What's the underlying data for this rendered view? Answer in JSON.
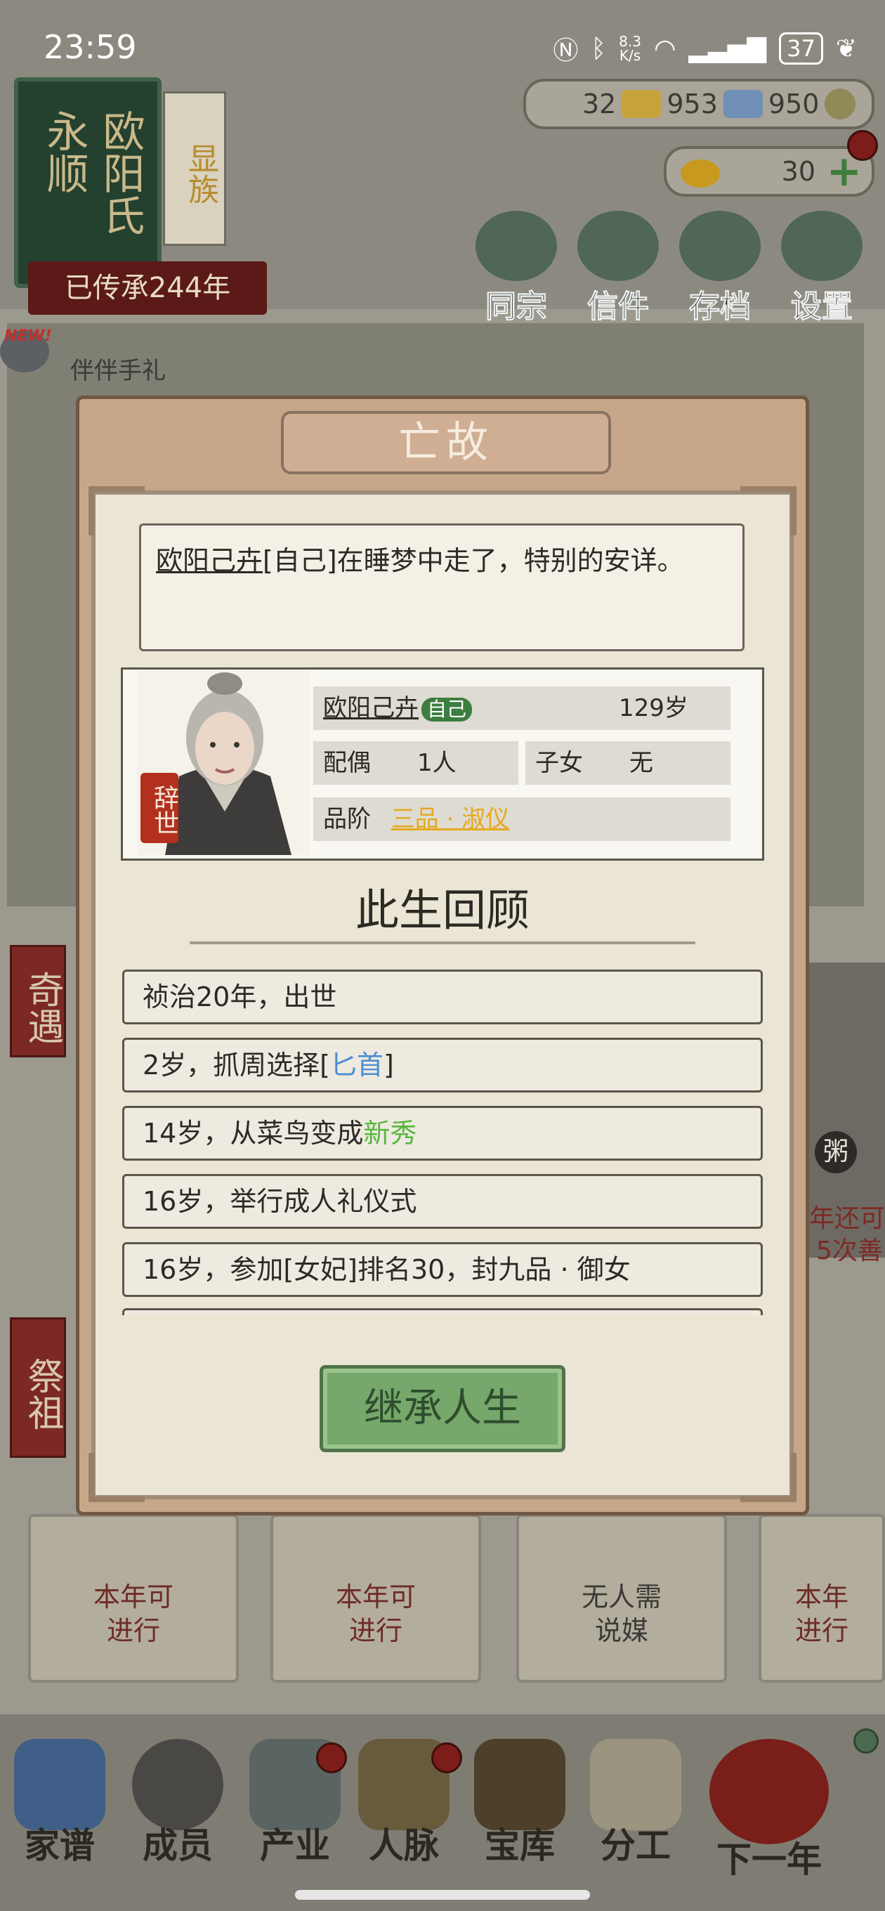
{
  "status_bar": {
    "time": "23:59",
    "net_speed_value": "8.3",
    "net_speed_unit": "K/s",
    "battery": "37"
  },
  "clan": {
    "name_col1": "欧阳氏",
    "name_col2": "永顺",
    "rank": "显族",
    "heritage": "已传承244年"
  },
  "currency": {
    "gold_bars": "32",
    "silver": "953",
    "coins": "950",
    "ingots": "30"
  },
  "top_menu": [
    {
      "label": "同宗",
      "icon": "book-icon"
    },
    {
      "label": "信件",
      "icon": "letter-icon"
    },
    {
      "label": "存档",
      "icon": "brush-icon"
    },
    {
      "label": "设置",
      "icon": "gear-icon"
    }
  ],
  "background": {
    "new_badge": "NEW!",
    "scroll_text": "伴伴手礼",
    "side_tag_1": "奇遇",
    "side_tag_2": "祭祖",
    "side_right_1": "年还可",
    "side_right_2": "5次善",
    "porridge": "粥",
    "cards": [
      {
        "line1": "本年可",
        "line2": "进行"
      },
      {
        "line1": "本年可",
        "line2": "进行"
      },
      {
        "line1": "无人需",
        "line2": "说媒"
      },
      {
        "line1": "本年",
        "line2": "进行"
      }
    ]
  },
  "bottom_nav": [
    {
      "label": "家谱",
      "icon": "family-tree-icon"
    },
    {
      "label": "成员",
      "icon": "member-icon"
    },
    {
      "label": "产业",
      "icon": "building-icon"
    },
    {
      "label": "人脉",
      "icon": "network-icon"
    },
    {
      "label": "宝库",
      "icon": "treasure-icon"
    },
    {
      "label": "分工",
      "icon": "scroll-icon"
    },
    {
      "label": "下一年",
      "icon": "lantern-icon"
    }
  ],
  "modal": {
    "title": "亡故",
    "event_name": "欧阳己卉",
    "event_self": "[自己]",
    "event_text": "在睡梦中走了，特别的安详。",
    "character": {
      "name": "欧阳己卉",
      "self_badge": "自己",
      "age": "129岁",
      "spouse_label": "配偶",
      "spouse_value": "1人",
      "children_label": "子女",
      "children_value": "无",
      "rank_label": "品阶",
      "rank_value": "三品 · 淑仪",
      "stamp": "辞世"
    },
    "review_title": "此生回顾",
    "life_events": [
      {
        "text": "祯治20年，出世"
      },
      {
        "pre": "2岁，抓周选择[",
        "highlight": "匕首",
        "post": "]"
      },
      {
        "pre": "14岁，从菜鸟变成",
        "highlight": "新秀",
        "post": ""
      },
      {
        "text": "16岁，举行成人礼仪式"
      },
      {
        "text": "16岁，参加[女妃]排名30，封九品 · 御女"
      }
    ],
    "inherit_button": "继承人生"
  }
}
